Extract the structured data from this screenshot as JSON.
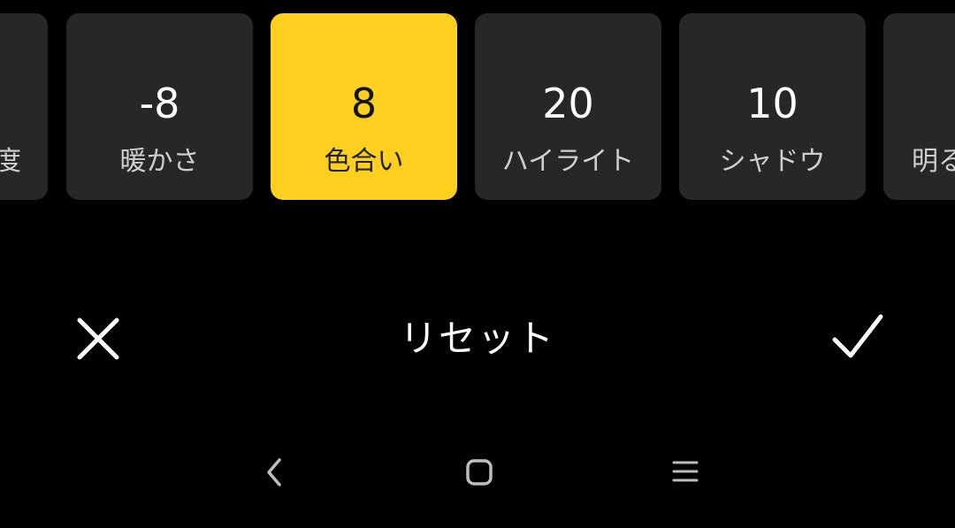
{
  "adjustments": [
    {
      "value": "",
      "label": "度",
      "state": "partial-left"
    },
    {
      "value": "-8",
      "label": "暖かさ",
      "state": "normal"
    },
    {
      "value": "8",
      "label": "色合い",
      "state": "selected"
    },
    {
      "value": "20",
      "label": "ハイライト",
      "state": "normal"
    },
    {
      "value": "10",
      "label": "シャドウ",
      "state": "normal"
    },
    {
      "value": "",
      "label": "明る",
      "state": "partial-right"
    }
  ],
  "actions": {
    "cancel_icon": "close-icon",
    "reset_label": "リセット",
    "confirm_icon": "check-icon"
  },
  "navigation": {
    "back_icon": "back-chevron-icon",
    "home_icon": "home-square-icon",
    "menu_icon": "menu-lines-icon"
  },
  "colors": {
    "background": "#000000",
    "tile": "#272727",
    "selected_tile": "#fdd01f",
    "text": "#ffffff"
  }
}
